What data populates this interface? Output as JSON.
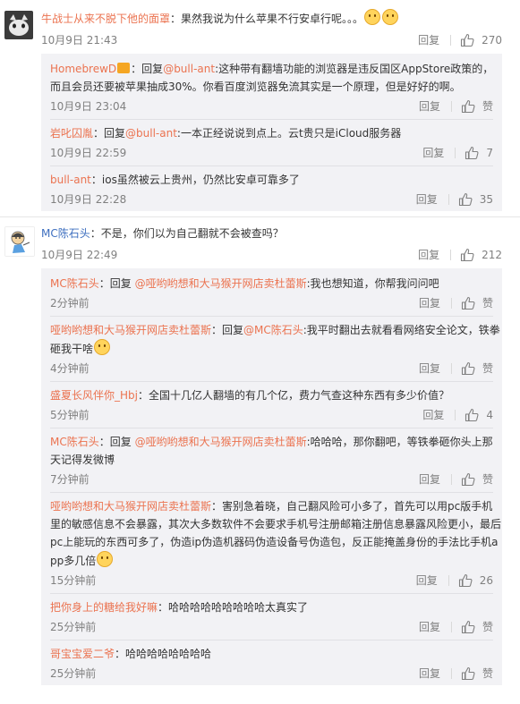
{
  "comments": [
    {
      "user": "牛战士从来不脱下他的面罩",
      "text": "：果然我说为什么苹果不行安卓行呢。。。",
      "time": "10月9日 21:43",
      "reply_label": "回复",
      "likes": "270",
      "replies": [
        {
          "user": "HomebrewD",
          "mention": "@bull-ant",
          "pre": "：回复",
          "text": ":这种带有翻墙功能的浏览器是违反国区AppStore政策的，而且会员还要被苹果抽成30%。你看百度浏览器免流其实是一个原理，但是好好的啊。",
          "time": "10月9日 23:04",
          "reply_label": "回复",
          "likes": "赞"
        },
        {
          "user": "岩叱囚胤",
          "mention": "@bull-ant",
          "pre": "：回复",
          "text": ":一本正经说说到点上。云t贵只是iCloud服务器",
          "time": "10月9日 22:59",
          "reply_label": "回复",
          "likes": "7"
        },
        {
          "user": "bull-ant",
          "mention": "",
          "pre": "",
          "text": "：ios虽然被云上贵州，仍然比安卓可靠多了",
          "time": "10月9日 22:28",
          "reply_label": "回复",
          "likes": "35"
        }
      ]
    },
    {
      "user": "MC陈石头",
      "text": "：不是，你们以为自己翻就不会被查吗？",
      "time": "10月9日 22:49",
      "reply_label": "回复",
      "likes": "212",
      "replies": [
        {
          "user": "MC陈石头",
          "pre": "：回复 ",
          "mention": "@哑哟哟想和大马猴开网店卖杜蕾斯",
          "text": ":我也想知道，你帮我问问吧",
          "time": "2分钟前",
          "reply_label": "回复",
          "likes": "赞"
        },
        {
          "user": "哑哟哟想和大马猴开网店卖杜蕾斯",
          "pre": "：回复",
          "mention": "@MC陈石头",
          "text": ":我平时翻出去就看看网络安全论文，铁拳砸我干啥",
          "time": "4分钟前",
          "reply_label": "回复",
          "likes": "赞"
        },
        {
          "user": "盛夏长风伴你_Hbj",
          "pre": "",
          "mention": "",
          "text": "：全国十几亿人翻墙的有几个亿，费力气查这种东西有多少价值？",
          "time": "5分钟前",
          "reply_label": "回复",
          "likes": "4"
        },
        {
          "user": "MC陈石头",
          "pre": "：回复 ",
          "mention": "@哑哟哟想和大马猴开网店卖杜蕾斯",
          "text": ":哈哈哈，那你翻吧，等铁拳砸你头上那天记得发微博",
          "time": "7分钟前",
          "reply_label": "回复",
          "likes": "赞"
        },
        {
          "user": "哑哟哟想和大马猴开网店卖杜蕾斯",
          "pre": "",
          "mention": "",
          "text": "：害别急着晓，自己翻风险可小多了，首先可以用pc版手机里的敏感信息不会暴露，其次大多数软件不会要求手机号注册邮箱注册信息暴露风险更小，最后pc上能玩的东西可多了，伪造ip伪造机器码伪造设备号伪造包，反正能掩盖身份的手法比手机app多几倍",
          "time": "15分钟前",
          "reply_label": "回复",
          "likes": "26"
        },
        {
          "user": "把你身上的糖给我好嘛",
          "pre": "",
          "mention": "",
          "text": "：哈哈哈哈哈哈哈哈哈太真实了",
          "time": "25分钟前",
          "reply_label": "回复",
          "likes": "赞"
        },
        {
          "user": "哥宝宝爱二爷",
          "pre": "",
          "mention": "",
          "text": "：哈哈哈哈哈哈哈哈",
          "time": "25分钟前",
          "reply_label": "回复",
          "likes": "赞"
        }
      ]
    }
  ]
}
